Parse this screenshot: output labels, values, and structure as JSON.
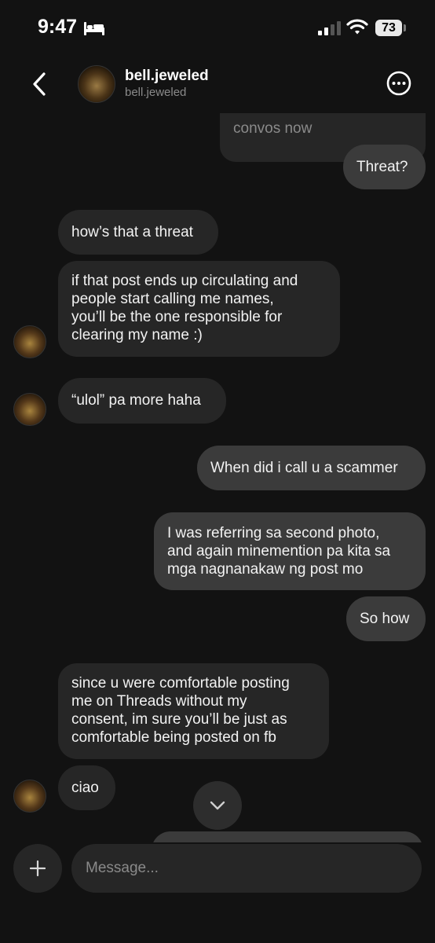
{
  "status_bar": {
    "time": "9:47",
    "battery": "73"
  },
  "header": {
    "name": "bell.jeweled",
    "username": "bell.jeweled"
  },
  "messages": [
    {
      "from": "them",
      "lines": [
        "convos now"
      ]
    },
    {
      "from": "me",
      "lines": [
        "Threat?"
      ]
    },
    {
      "from": "them",
      "lines": [
        "how’s that a threat"
      ]
    },
    {
      "from": "them",
      "lines": [
        "if that post ends up circulating and",
        "people start calling me names,",
        "you’ll be the one responsible for",
        "clearing my name :)"
      ]
    },
    {
      "from": "them",
      "lines": [
        "“ulol” pa more haha"
      ]
    },
    {
      "from": "me",
      "lines": [
        "When did i call u a scammer"
      ]
    },
    {
      "from": "me",
      "lines": [
        "I was referring sa second photo,",
        "and again minemention pa kita sa",
        "mga nagnanakaw ng post mo"
      ]
    },
    {
      "from": "me",
      "lines": [
        "So how"
      ]
    },
    {
      "from": "them",
      "lines": [
        "since u were comfortable posting",
        "me on Threads without my",
        "consent, im sure you’ll be just as",
        "comfortable being posted on fb"
      ]
    },
    {
      "from": "them",
      "lines": [
        "ciao"
      ]
    }
  ],
  "composer": {
    "placeholder": "Message..."
  },
  "icons": {
    "back": "chevron-left-icon",
    "more": "more-horizontal-circle-icon",
    "scroll": "chevron-down-icon",
    "plus": "plus-icon",
    "sleep": "bed-icon",
    "signal": "cellular-signal-icon",
    "wifi": "wifi-icon"
  },
  "colors": {
    "background": "#121212",
    "incoming_bubble": "#262626",
    "outgoing_bubble": "#3b3b3b"
  }
}
